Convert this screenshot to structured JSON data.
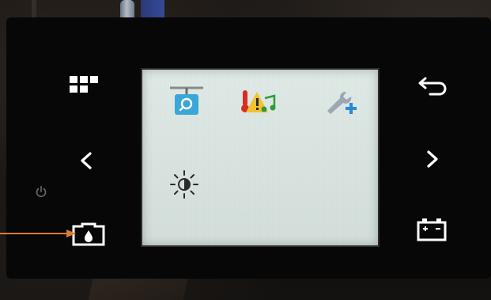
{
  "device": {
    "screen_bg": "#d9e4e1",
    "panel_color": "#070707",
    "button_color": "#ffffff",
    "power_indicator_color": "#6a6a6a"
  },
  "lcd_icons": [
    {
      "name": "camera-inspection-icon",
      "colors": [
        "#8a8a8a",
        "#3aa7d8"
      ]
    },
    {
      "name": "temperature-alarm-sound-icon",
      "colors": [
        "#d62d20",
        "#f2c230",
        "#2f9a3a"
      ]
    },
    {
      "name": "wrench-add-icon",
      "colors": [
        "#9aa7b4",
        "#2a8ad8"
      ]
    },
    {
      "name": "brightness-icon",
      "colors": [
        "#2b2b2b"
      ]
    }
  ],
  "left_buttons": [
    {
      "name": "grid-menu-icon"
    },
    {
      "name": "chevron-left-icon"
    },
    {
      "name": "power-indicator-icon"
    },
    {
      "name": "tank-fluid-icon"
    }
  ],
  "right_buttons": [
    {
      "name": "back-arrow-icon"
    },
    {
      "name": "chevron-right-icon"
    },
    {
      "name": "battery-icon"
    }
  ],
  "annotation": {
    "arrow_color": "#e07b2a",
    "target": "tank-fluid-icon"
  }
}
